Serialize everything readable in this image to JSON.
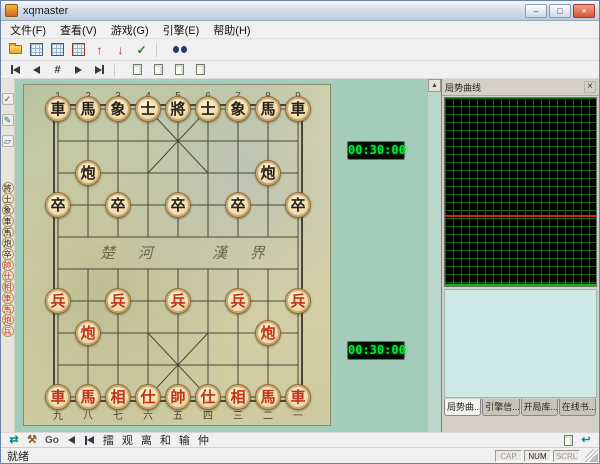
{
  "window": {
    "title": "xqmaster",
    "minimize": "–",
    "maximize": "□",
    "close": "×"
  },
  "menu": [
    {
      "label": "文件(F)"
    },
    {
      "label": "查看(V)"
    },
    {
      "label": "游戏(G)"
    },
    {
      "label": "引擎(E)"
    },
    {
      "label": "帮助(H)"
    }
  ],
  "toolbar_main": [
    {
      "name": "open-file",
      "glyph": "folder"
    },
    {
      "name": "new-board",
      "glyph": "board"
    },
    {
      "name": "copy-board",
      "glyph": "board"
    },
    {
      "name": "edit-board",
      "glyph": "board-red"
    },
    {
      "name": "takeback-move",
      "glyph": "up"
    },
    {
      "name": "forward-move",
      "glyph": "down"
    },
    {
      "name": "engine-analyze",
      "glyph": "check"
    },
    {
      "name": "sep",
      "glyph": "sep"
    },
    {
      "name": "search-position",
      "glyph": "binoculars"
    }
  ],
  "toolbar_nav": [
    {
      "name": "nav-first",
      "glyph": "first"
    },
    {
      "name": "nav-prev",
      "glyph": "prev"
    },
    {
      "name": "nav-goto-move",
      "glyph": "hash"
    },
    {
      "name": "nav-next",
      "glyph": "next"
    },
    {
      "name": "nav-last",
      "glyph": "last"
    },
    {
      "name": "sep",
      "glyph": "sep"
    },
    {
      "name": "copy-game",
      "glyph": "page"
    },
    {
      "name": "copy-fen",
      "glyph": "page"
    },
    {
      "name": "paste-game",
      "glyph": "page"
    },
    {
      "name": "paste-fen",
      "glyph": "page"
    }
  ],
  "palette": {
    "tools": [
      {
        "name": "confirm-check",
        "glyph": "✓"
      },
      {
        "name": "edit-pencil",
        "glyph": "✎"
      },
      {
        "name": "eraser",
        "glyph": "▱"
      }
    ],
    "pieces": [
      {
        "t": "將",
        "s": "b"
      },
      {
        "t": "士",
        "s": "b"
      },
      {
        "t": "象",
        "s": "b"
      },
      {
        "t": "車",
        "s": "b"
      },
      {
        "t": "馬",
        "s": "b"
      },
      {
        "t": "炮",
        "s": "b"
      },
      {
        "t": "卒",
        "s": "b"
      },
      {
        "t": "帥",
        "s": "r"
      },
      {
        "t": "仕",
        "s": "r"
      },
      {
        "t": "相",
        "s": "r"
      },
      {
        "t": "車",
        "s": "r"
      },
      {
        "t": "馬",
        "s": "r"
      },
      {
        "t": "炮",
        "s": "r"
      },
      {
        "t": "兵",
        "s": "r"
      }
    ]
  },
  "board": {
    "top_labels": [
      "1",
      "2",
      "3",
      "4",
      "5",
      "6",
      "7",
      "8",
      "9"
    ],
    "bottom_labels": [
      "九",
      "八",
      "七",
      "六",
      "五",
      "四",
      "三",
      "二",
      "一"
    ],
    "river": {
      "left": "楚 河",
      "right": "漢 界"
    },
    "pieces": [
      {
        "c": 0,
        "r": 0,
        "t": "車",
        "s": "b"
      },
      {
        "c": 1,
        "r": 0,
        "t": "馬",
        "s": "b"
      },
      {
        "c": 2,
        "r": 0,
        "t": "象",
        "s": "b"
      },
      {
        "c": 3,
        "r": 0,
        "t": "士",
        "s": "b"
      },
      {
        "c": 4,
        "r": 0,
        "t": "將",
        "s": "b"
      },
      {
        "c": 5,
        "r": 0,
        "t": "士",
        "s": "b"
      },
      {
        "c": 6,
        "r": 0,
        "t": "象",
        "s": "b"
      },
      {
        "c": 7,
        "r": 0,
        "t": "馬",
        "s": "b"
      },
      {
        "c": 8,
        "r": 0,
        "t": "車",
        "s": "b"
      },
      {
        "c": 1,
        "r": 2,
        "t": "炮",
        "s": "b"
      },
      {
        "c": 7,
        "r": 2,
        "t": "炮",
        "s": "b"
      },
      {
        "c": 0,
        "r": 3,
        "t": "卒",
        "s": "b"
      },
      {
        "c": 2,
        "r": 3,
        "t": "卒",
        "s": "b"
      },
      {
        "c": 4,
        "r": 3,
        "t": "卒",
        "s": "b"
      },
      {
        "c": 6,
        "r": 3,
        "t": "卒",
        "s": "b"
      },
      {
        "c": 8,
        "r": 3,
        "t": "卒",
        "s": "b"
      },
      {
        "c": 0,
        "r": 6,
        "t": "兵",
        "s": "r"
      },
      {
        "c": 2,
        "r": 6,
        "t": "兵",
        "s": "r"
      },
      {
        "c": 4,
        "r": 6,
        "t": "兵",
        "s": "r"
      },
      {
        "c": 6,
        "r": 6,
        "t": "兵",
        "s": "r"
      },
      {
        "c": 8,
        "r": 6,
        "t": "兵",
        "s": "r"
      },
      {
        "c": 1,
        "r": 7,
        "t": "炮",
        "s": "r"
      },
      {
        "c": 7,
        "r": 7,
        "t": "炮",
        "s": "r"
      },
      {
        "c": 0,
        "r": 9,
        "t": "車",
        "s": "r"
      },
      {
        "c": 1,
        "r": 9,
        "t": "馬",
        "s": "r"
      },
      {
        "c": 2,
        "r": 9,
        "t": "相",
        "s": "r"
      },
      {
        "c": 3,
        "r": 9,
        "t": "仕",
        "s": "r"
      },
      {
        "c": 4,
        "r": 9,
        "t": "帥",
        "s": "r"
      },
      {
        "c": 5,
        "r": 9,
        "t": "仕",
        "s": "r"
      },
      {
        "c": 6,
        "r": 9,
        "t": "相",
        "s": "r"
      },
      {
        "c": 7,
        "r": 9,
        "t": "馬",
        "s": "r"
      },
      {
        "c": 8,
        "r": 9,
        "t": "車",
        "s": "r"
      }
    ]
  },
  "clocks": {
    "black": "00:30:00",
    "red": "00:30:00"
  },
  "panel": {
    "title": "局势曲线",
    "close": "×",
    "graph": {
      "red_line_pos": 0.62
    },
    "tabs": [
      "局势曲...",
      "引擎信...",
      "开局库...",
      "在线书..."
    ]
  },
  "bottom": {
    "go": "Go",
    "actions": [
      "擂",
      "观",
      "离",
      "和",
      "输",
      "仲"
    ]
  },
  "status": {
    "text": "就绪",
    "caps": "CAP",
    "num": "NUM",
    "scrl": "SCRL"
  },
  "colors": {
    "panel_bg": "#a3ccba",
    "led_green": "#00e83c",
    "graph_red_line": "#d62020",
    "piece_red": "#c23318",
    "piece_black": "#2a2018"
  }
}
